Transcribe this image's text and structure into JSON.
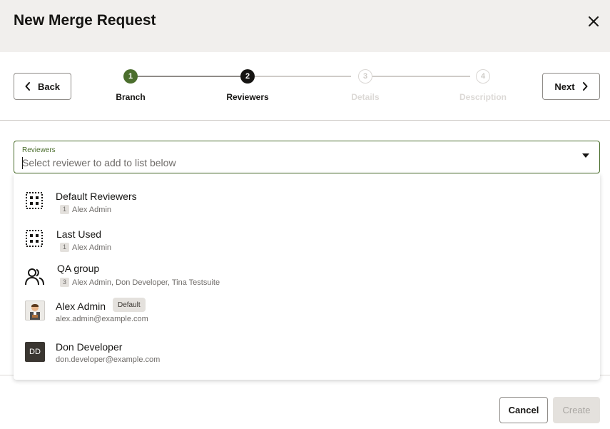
{
  "header": {
    "title": "New Merge Request",
    "close_icon": "close-icon"
  },
  "nav": {
    "back_label": "Back",
    "next_label": "Next"
  },
  "train": {
    "steps": [
      {
        "number": "1",
        "label": "Branch",
        "state": "done"
      },
      {
        "number": "2",
        "label": "Reviewers",
        "state": "current"
      },
      {
        "number": "3",
        "label": "Details",
        "state": "todo"
      },
      {
        "number": "4",
        "label": "Description",
        "state": "todo"
      }
    ]
  },
  "reviewers_field": {
    "label": "Reviewers",
    "placeholder": "Select reviewer to add to list below",
    "value": ""
  },
  "options": [
    {
      "icon": "grid-icon",
      "name": "Default Reviewers",
      "count": "1",
      "members": "Alex Admin"
    },
    {
      "icon": "grid-icon",
      "name": "Last Used",
      "count": "1",
      "members": "Alex Admin"
    },
    {
      "icon": "group-icon",
      "name": "QA group",
      "count": "3",
      "members": "Alex Admin, Don Developer, Tina Testsuite"
    },
    {
      "icon": "avatar-photo",
      "name": "Alex Admin",
      "badge": "Default",
      "email": "alex.admin@example.com"
    },
    {
      "icon": "avatar-initials",
      "initials": "DD",
      "name": "Don Developer",
      "email": "don.developer@example.com"
    }
  ],
  "footer": {
    "cancel_label": "Cancel",
    "create_label": "Create"
  },
  "colors": {
    "accent": "#4b6e2d",
    "header_bg": "#f1efed",
    "text": "#161513"
  }
}
